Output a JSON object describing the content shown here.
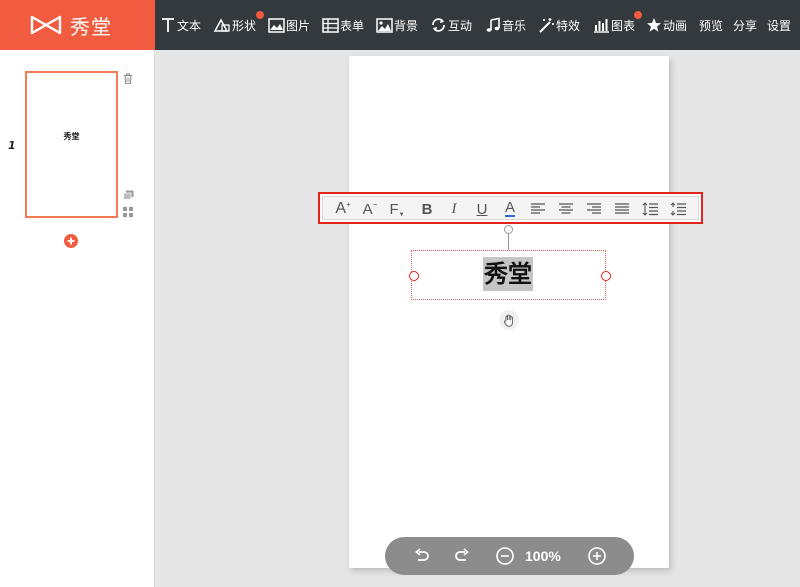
{
  "app": {
    "logo_text": "秀堂"
  },
  "nav": {
    "text": "文本",
    "shape": "形状",
    "image": "图片",
    "form": "表单",
    "background": "背景",
    "interactive": "互动",
    "music": "音乐",
    "effects": "特效",
    "chart": "图表",
    "animation": "动画",
    "preview": "预览",
    "share": "分享",
    "settings": "设置"
  },
  "slides": {
    "number": "1",
    "thumb_text": "秀堂"
  },
  "canvas": {
    "text": "秀堂"
  },
  "toolbar": {
    "font_increase": "A",
    "font_decrease": "A",
    "font_family": "F",
    "bold": "B",
    "italic": "I",
    "underline": "U",
    "font_color": "A"
  },
  "zoom": {
    "level": "100%"
  },
  "colors": {
    "accent": "#f15b40",
    "topbar": "#34393e",
    "selection": "#e0241a"
  }
}
